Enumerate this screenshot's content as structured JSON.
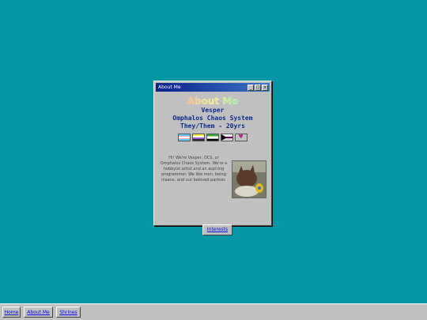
{
  "window": {
    "title": "About Me",
    "controls": [
      "_",
      "□",
      "×"
    ]
  },
  "about": {
    "heading": "About Me",
    "name": "Vesper",
    "system": "Omphalos Chaos System",
    "pronouns_age": "They/Them - 20yrs",
    "flags": [
      "transgender-flag",
      "nonbinary-flag",
      "aromantic-flag",
      "demisexual-flag",
      "bisexual-heart-flag"
    ],
    "bio": "Hi! We're Vesper, OCS, or Omphalos Chaos System. We're a hobbyist artist and an aspiring programmer. We like men, being insane, and our beloved partner.",
    "interests_label": "Interests"
  },
  "taskbar": {
    "items": [
      "Home",
      "About Me",
      "Shrines"
    ]
  },
  "colors": {
    "desktop": "#0397a5",
    "title_text": "#0b2a8f"
  }
}
